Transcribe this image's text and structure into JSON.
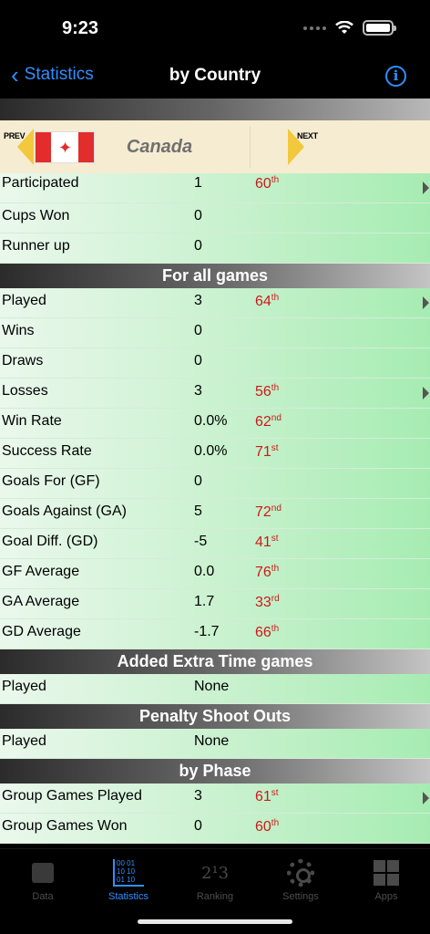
{
  "status_bar": {
    "time": "9:23"
  },
  "nav": {
    "back_label": "Statistics",
    "title": "by Country",
    "info_glyph": "i"
  },
  "country_header": {
    "prev_label": "PREV",
    "next_label": "NEXT",
    "country": "Canada"
  },
  "summary_rows": [
    {
      "label": "Participated",
      "value": "1",
      "rank": "60",
      "suffix": "th",
      "disclosure": true
    },
    {
      "label": "Cups Won",
      "value": "0",
      "rank": "",
      "suffix": "",
      "disclosure": false
    },
    {
      "label": "Runner up",
      "value": "0",
      "rank": "",
      "suffix": "",
      "disclosure": false
    }
  ],
  "sections": {
    "all_games": {
      "title": "For all games",
      "rows": [
        {
          "label": "Played",
          "value": "3",
          "rank": "64",
          "suffix": "th",
          "disclosure": true
        },
        {
          "label": "Wins",
          "value": "0",
          "rank": "",
          "suffix": "",
          "disclosure": false
        },
        {
          "label": "Draws",
          "value": "0",
          "rank": "",
          "suffix": "",
          "disclosure": false
        },
        {
          "label": "Losses",
          "value": "3",
          "rank": "56",
          "suffix": "th",
          "disclosure": true
        },
        {
          "label": "Win Rate",
          "value": "0.0%",
          "rank": "62",
          "suffix": "nd",
          "disclosure": false
        },
        {
          "label": "Success Rate",
          "value": "0.0%",
          "rank": "71",
          "suffix": "st",
          "disclosure": false
        },
        {
          "label": "Goals For (GF)",
          "value": "0",
          "rank": "",
          "suffix": "",
          "disclosure": false
        },
        {
          "label": "Goals Against (GA)",
          "value": "5",
          "rank": "72",
          "suffix": "nd",
          "disclosure": false
        },
        {
          "label": "Goal Diff. (GD)",
          "value": "-5",
          "rank": "41",
          "suffix": "st",
          "disclosure": false
        },
        {
          "label": "GF Average",
          "value": "0.0",
          "rank": "76",
          "suffix": "th",
          "disclosure": false
        },
        {
          "label": "GA Average",
          "value": "1.7",
          "rank": "33",
          "suffix": "rd",
          "disclosure": false
        },
        {
          "label": "GD Average",
          "value": "-1.7",
          "rank": "66",
          "suffix": "th",
          "disclosure": false
        }
      ]
    },
    "extra_time": {
      "title": "Added Extra Time games",
      "rows": [
        {
          "label": "Played",
          "value": "None",
          "rank": "",
          "suffix": "",
          "disclosure": false
        }
      ]
    },
    "penalty": {
      "title": "Penalty Shoot Outs",
      "rows": [
        {
          "label": "Played",
          "value": "None",
          "rank": "",
          "suffix": "",
          "disclosure": false
        }
      ]
    },
    "phase": {
      "title": "by Phase",
      "rows": [
        {
          "label": "Group Games Played",
          "value": "3",
          "rank": "61",
          "suffix": "st",
          "disclosure": true
        },
        {
          "label": "Group Games Won",
          "value": "0",
          "rank": "60",
          "suffix": "th",
          "disclosure": false
        }
      ]
    }
  },
  "tabs": [
    {
      "label": "Data",
      "icon": "data-icon",
      "active": false
    },
    {
      "label": "Statistics",
      "icon": "statistics-icon",
      "active": true
    },
    {
      "label": "Ranking",
      "icon": "ranking-icon",
      "active": false
    },
    {
      "label": "Settings",
      "icon": "gear-icon",
      "active": false
    },
    {
      "label": "Apps",
      "icon": "apps-icon",
      "active": false
    }
  ],
  "colors": {
    "accent": "#2f8fff",
    "rank_red": "#cc1a1a",
    "row_green": "#c7f1cd",
    "header_cream": "#f6ecd2"
  }
}
